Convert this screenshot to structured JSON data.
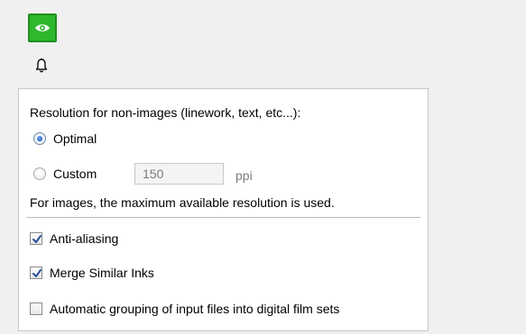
{
  "icons": {
    "eye_button": "eye-icon",
    "bell": "bell-icon",
    "eye_button_color": "#2eb82e"
  },
  "resolution": {
    "heading": "Resolution for non-images (linework, text, etc...):",
    "options": [
      {
        "label": "Optimal",
        "checked": true
      },
      {
        "label": "Custom",
        "checked": false
      }
    ],
    "custom_value": "150",
    "custom_placeholder": "",
    "unit": "ppi",
    "images_note": "For images, the maximum available resolution is used."
  },
  "checkboxes": [
    {
      "label": "Anti-aliasing",
      "checked": true
    },
    {
      "label": "Merge Similar Inks",
      "checked": true
    },
    {
      "label": "Automatic grouping of input files into digital film sets",
      "checked": false
    }
  ]
}
